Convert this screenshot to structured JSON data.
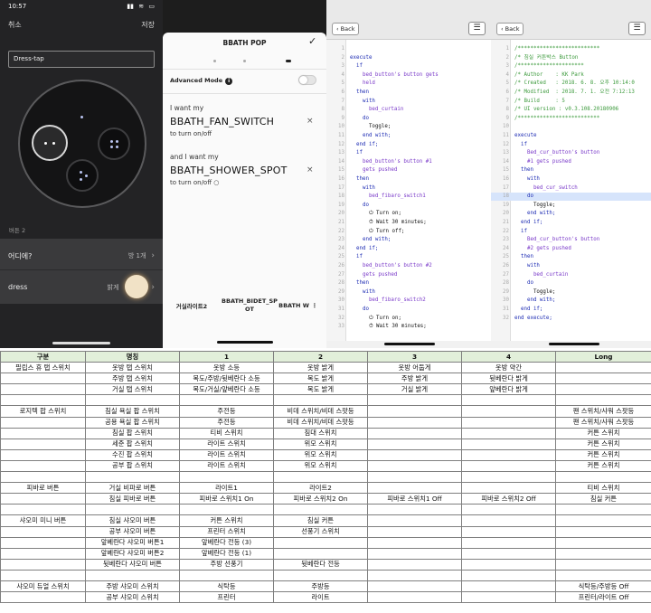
{
  "panel1": {
    "time": "10:57",
    "icons": [
      "signal-icon",
      "wifi-icon",
      "battery-icon"
    ],
    "cancel": "취소",
    "save": "저장",
    "name_value": "Dress-tap",
    "section": "버튼 2",
    "row1_label": "어디에?",
    "row1_value": "방 1개",
    "row2_label": "dress",
    "row2_value": "밝게"
  },
  "panel2": {
    "title": "BBATH POP",
    "advanced": "Advanced Mode",
    "want1": "I want my",
    "device1": "BBATH_FAN_SWITCH",
    "action1": "to turn on/off",
    "want2": "and I want my",
    "device2": "BBATH_SHOWER_SPOT",
    "action2": "to turn on/off",
    "tabs": [
      "거실라이트2",
      "BBATH_BIDET_SP OT",
      "BBATH W"
    ]
  },
  "code1": {
    "back": "Back",
    "lines": [
      {
        "n": "1",
        "t": "",
        "c": ""
      },
      {
        "n": "2",
        "t": "execute",
        "c": "kw"
      },
      {
        "n": "3",
        "t": "  if",
        "c": "kw"
      },
      {
        "n": "4",
        "t": "    bed_button's button gets",
        "c": "idt"
      },
      {
        "n": "5",
        "t": "    held",
        "c": "idt"
      },
      {
        "n": "6",
        "t": "  then",
        "c": "kw"
      },
      {
        "n": "7",
        "t": "    with",
        "c": "kw"
      },
      {
        "n": "8",
        "t": "      bed_curtain",
        "c": "idt"
      },
      {
        "n": "9",
        "t": "    do",
        "c": "kw"
      },
      {
        "n": "10",
        "t": "      Toggle;",
        "c": ""
      },
      {
        "n": "11",
        "t": "    end with;",
        "c": "kw"
      },
      {
        "n": "12",
        "t": "  end if;",
        "c": "kw"
      },
      {
        "n": "13",
        "t": "  if",
        "c": "kw"
      },
      {
        "n": "14",
        "t": "    bed_button's button #1",
        "c": "idt"
      },
      {
        "n": "15",
        "t": "    gets pushed",
        "c": "idt"
      },
      {
        "n": "16",
        "t": "  then",
        "c": "kw"
      },
      {
        "n": "17",
        "t": "    with",
        "c": "kw"
      },
      {
        "n": "18",
        "t": "      bed_fibaro_switch1",
        "c": "idt"
      },
      {
        "n": "19",
        "t": "    do",
        "c": "kw"
      },
      {
        "n": "20",
        "t": "      ⏻ Turn on;",
        "c": ""
      },
      {
        "n": "21",
        "t": "      ⏱ Wait 30 minutes;",
        "c": ""
      },
      {
        "n": "22",
        "t": "      ⏻ Turn off;",
        "c": ""
      },
      {
        "n": "23",
        "t": "    end with;",
        "c": "kw"
      },
      {
        "n": "24",
        "t": "  end if;",
        "c": "kw"
      },
      {
        "n": "25",
        "t": "  if",
        "c": "kw"
      },
      {
        "n": "26",
        "t": "    bed_button's button #2",
        "c": "idt"
      },
      {
        "n": "27",
        "t": "    gets pushed",
        "c": "idt"
      },
      {
        "n": "28",
        "t": "  then",
        "c": "kw"
      },
      {
        "n": "29",
        "t": "    with",
        "c": "kw"
      },
      {
        "n": "30",
        "t": "      bed_fibaro_switch2",
        "c": "idt"
      },
      {
        "n": "31",
        "t": "    do",
        "c": "kw"
      },
      {
        "n": "32",
        "t": "      ⏻ Turn on;",
        "c": ""
      },
      {
        "n": "33",
        "t": "      ⏱ Wait 30 minutes;",
        "c": ""
      }
    ]
  },
  "code2": {
    "back": "Back",
    "lines": [
      {
        "n": "1",
        "t": "/**************************",
        "c": "cm"
      },
      {
        "n": "2",
        "t": "/* 침실 커튼박스 Button",
        "c": "cm"
      },
      {
        "n": "3",
        "t": "/*********************",
        "c": "cm"
      },
      {
        "n": "4",
        "t": "/* Author    : KK Park",
        "c": "cm"
      },
      {
        "n": "5",
        "t": "/* Created   : 2018. 6. 8. 오후 10:14:0",
        "c": "cm"
      },
      {
        "n": "6",
        "t": "/* Modified  : 2018. 7. 1. 오전 7:12:13",
        "c": "cm"
      },
      {
        "n": "7",
        "t": "/* Build     : 5",
        "c": "cm"
      },
      {
        "n": "8",
        "t": "/* UI version : v0.3.108.20180906",
        "c": "cm"
      },
      {
        "n": "9",
        "t": "/**************************",
        "c": "cm"
      },
      {
        "n": "10",
        "t": "",
        "c": ""
      },
      {
        "n": "11",
        "t": "execute",
        "c": "kw"
      },
      {
        "n": "12",
        "t": "  if",
        "c": "kw"
      },
      {
        "n": "13",
        "t": "    Bed_cur_button's button",
        "c": "idt"
      },
      {
        "n": "14",
        "t": "    #1 gets pushed",
        "c": "idt"
      },
      {
        "n": "15",
        "t": "  then",
        "c": "kw"
      },
      {
        "n": "16",
        "t": "    with",
        "c": "kw"
      },
      {
        "n": "17",
        "t": "      bed_cur_switch",
        "c": "idt"
      },
      {
        "n": "18",
        "t": "    do",
        "c": "kw"
      },
      {
        "n": "19",
        "t": "      Toggle;",
        "c": ""
      },
      {
        "n": "20",
        "t": "    end with;",
        "c": "kw"
      },
      {
        "n": "21",
        "t": "  end if;",
        "c": "kw"
      },
      {
        "n": "22",
        "t": "  if",
        "c": "kw"
      },
      {
        "n": "23",
        "t": "    Bed_cur_button's button",
        "c": "idt"
      },
      {
        "n": "24",
        "t": "    #2 gets pushed",
        "c": "idt"
      },
      {
        "n": "25",
        "t": "  then",
        "c": "kw"
      },
      {
        "n": "26",
        "t": "    with",
        "c": "kw"
      },
      {
        "n": "27",
        "t": "      bed_curtain",
        "c": "idt"
      },
      {
        "n": "28",
        "t": "    do",
        "c": "kw"
      },
      {
        "n": "29",
        "t": "      Toggle;",
        "c": ""
      },
      {
        "n": "30",
        "t": "    end with;",
        "c": "kw"
      },
      {
        "n": "31",
        "t": "  end if;",
        "c": "kw"
      },
      {
        "n": "32",
        "t": "end execute;",
        "c": "kw"
      }
    ]
  },
  "table": {
    "headers": [
      "구분",
      "명칭",
      "1",
      "2",
      "3",
      "4",
      "Long"
    ],
    "rows": [
      [
        "필립스 휴 탭 스위치",
        "옷방 탭 스위치",
        "옷방 소등",
        "옷방 밝게",
        "옷방 어둡게",
        "옷방 약간",
        ""
      ],
      [
        "",
        "주방 탭 스위치",
        "복도/주방/뒷베란다 소등",
        "복도 밝게",
        "주방 밝게",
        "뒷베란다 밝게",
        ""
      ],
      [
        "",
        "거실 탭 스위치",
        "복도/거실/앞베란다 소등",
        "복도 밝게",
        "거실 밝게",
        "앞베란다 밝게",
        ""
      ],
      [
        "",
        "",
        "",
        "",
        "",
        "",
        ""
      ],
      [
        "로지텍 팝 스위치",
        "침실 욕실 팝 스위치",
        "주전등",
        "비데 스위치/비데 스팟등",
        "",
        "",
        "팬 스위치/샤워 스팟등"
      ],
      [
        "",
        "공용 욕실 팝 스위치",
        "주전등",
        "비데 스위치/비데 스팟등",
        "",
        "",
        "팬 스위치/샤워 스팟등"
      ],
      [
        "",
        "침실 팝 스위치",
        "티비 스위치",
        "침대 스위치",
        "",
        "",
        "커튼 스위치"
      ],
      [
        "",
        "세준 팝 스위치",
        "라이트 스위치",
        "위모 스위치",
        "",
        "",
        "커튼 스위치"
      ],
      [
        "",
        "수진 팝 스위치",
        "라이트 스위치",
        "위모 스위치",
        "",
        "",
        "커튼 스위치"
      ],
      [
        "",
        "공부 팝 스위치",
        "라이트 스위치",
        "위모 스위치",
        "",
        "",
        "커튼 스위치"
      ],
      [
        "",
        "",
        "",
        "",
        "",
        "",
        ""
      ],
      [
        "피바로 버튼",
        "거실 비파로 버튼",
        "라이트1",
        "라이트2",
        "",
        "",
        "티비 스위치"
      ],
      [
        "",
        "침실 피바로 버튼",
        "피바로 스위치1 On",
        "피바로 스위치2 On",
        "피바로 스위치1 Off",
        "피바로 스위치2 Off",
        "침실 커튼"
      ],
      [
        "",
        "",
        "",
        "",
        "",
        "",
        ""
      ],
      [
        "샤오미 미니 버튼",
        "침실 샤오미 버튼",
        "커튼 스위치",
        "침실 커튼",
        "",
        "",
        ""
      ],
      [
        "",
        "공부 샤오미 버튼",
        "프린터 스위치",
        "선풍기 스위치",
        "",
        "",
        ""
      ],
      [
        "",
        "앞베란다 샤오미 버튼1",
        "앞베란다 전등 (3)",
        "",
        "",
        "",
        ""
      ],
      [
        "",
        "앞베란다 샤오미 버튼2",
        "앞베란다 전등 (1)",
        "",
        "",
        "",
        ""
      ],
      [
        "",
        "뒷베란다 샤오미 버튼",
        "주방 선풍기",
        "뒷베란다 전등",
        "",
        "",
        ""
      ],
      [
        "",
        "",
        "",
        "",
        "",
        "",
        ""
      ],
      [
        "샤오미 듀얼 스위치",
        "주방 샤오미 스위치",
        "식탁등",
        "주방등",
        "",
        "",
        "식탁등/주방등 Off"
      ],
      [
        "",
        "공부 샤오미 스위치",
        "프린터",
        "라이트",
        "",
        "",
        "프린터/라이트 Off"
      ]
    ]
  }
}
